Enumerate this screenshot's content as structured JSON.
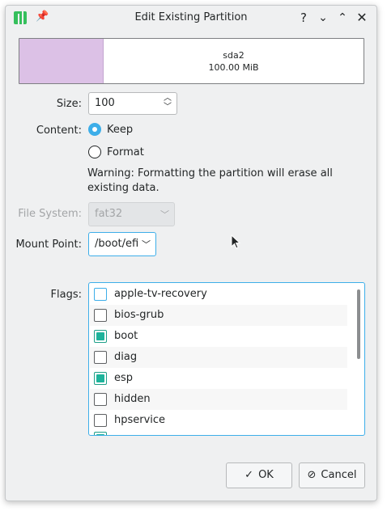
{
  "window": {
    "title": "Edit Existing Partition",
    "help_glyph": "?",
    "minimize_glyph": "⌄",
    "maximize_glyph": "⌃",
    "close_glyph": "✕",
    "pin_glyph": "📌"
  },
  "partition": {
    "name": "sda2",
    "size_text": "100.00 MiB",
    "used_color": "#dcc1e6"
  },
  "size": {
    "label": "Size:",
    "value": "100"
  },
  "content": {
    "label": "Content:",
    "options": [
      {
        "label": "Keep",
        "checked": true
      },
      {
        "label": "Format",
        "checked": false
      }
    ],
    "warning": "Warning: Formatting the partition will erase all existing data."
  },
  "file_system": {
    "label": "File System:",
    "value": "fat32",
    "disabled": true
  },
  "mount_point": {
    "label": "Mount Point:",
    "value": "/boot/efi"
  },
  "flags": {
    "label": "Flags:",
    "items": [
      {
        "label": "apple-tv-recovery",
        "checked": false
      },
      {
        "label": "bios-grub",
        "checked": false
      },
      {
        "label": "boot",
        "checked": true
      },
      {
        "label": "diag",
        "checked": false
      },
      {
        "label": "esp",
        "checked": true
      },
      {
        "label": "hidden",
        "checked": false
      },
      {
        "label": "hpservice",
        "checked": false
      }
    ]
  },
  "buttons": {
    "ok_icon": "✓",
    "ok_label": "OK",
    "cancel_icon": "⊘",
    "cancel_label": "Cancel"
  },
  "colors": {
    "accent": "#3daee9",
    "checked": "#1eb39b"
  }
}
